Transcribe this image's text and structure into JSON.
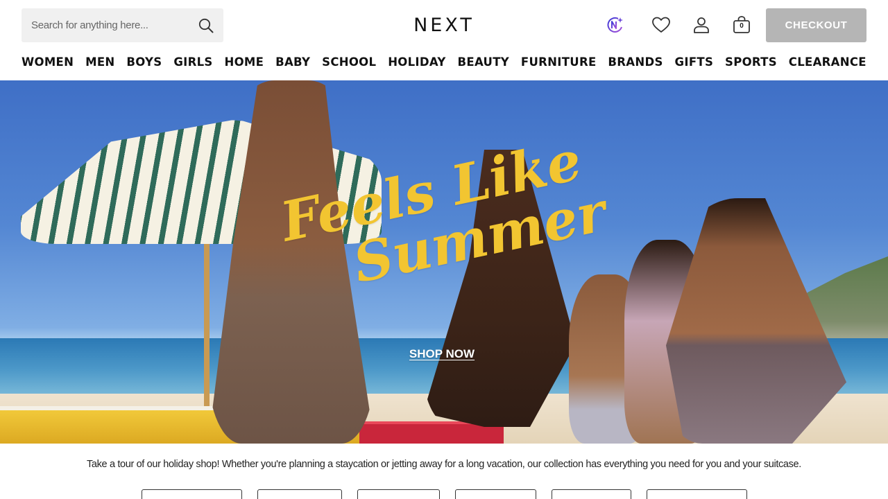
{
  "search": {
    "placeholder": "Search for anything here..."
  },
  "brand": {
    "logo": "NEXT"
  },
  "header": {
    "icons": [
      "next-ai-icon",
      "heart-icon",
      "account-icon",
      "bag-icon"
    ],
    "bag_count": "0",
    "checkout_label": "CHECKOUT"
  },
  "nav": {
    "items": [
      "WOMEN",
      "MEN",
      "BOYS",
      "GIRLS",
      "HOME",
      "BABY",
      "SCHOOL",
      "HOLIDAY",
      "BEAUTY",
      "FURNITURE",
      "BRANDS",
      "GIFTS",
      "SPORTS",
      "CLEARANCE"
    ]
  },
  "hero": {
    "headline_line1": "Feels Like",
    "headline_line2": "Summer",
    "cta": "SHOP NOW"
  },
  "intro": {
    "text": "Take a tour of our holiday shop! Whether you're planning a staycation or jetting away for a long vacation, our collection has everything you need for you and your suitcase."
  },
  "colors": {
    "checkout_bg": "#b5b5b5",
    "headline": "#f2c531",
    "text": "#222222",
    "search_bg": "#f0f0f0"
  }
}
